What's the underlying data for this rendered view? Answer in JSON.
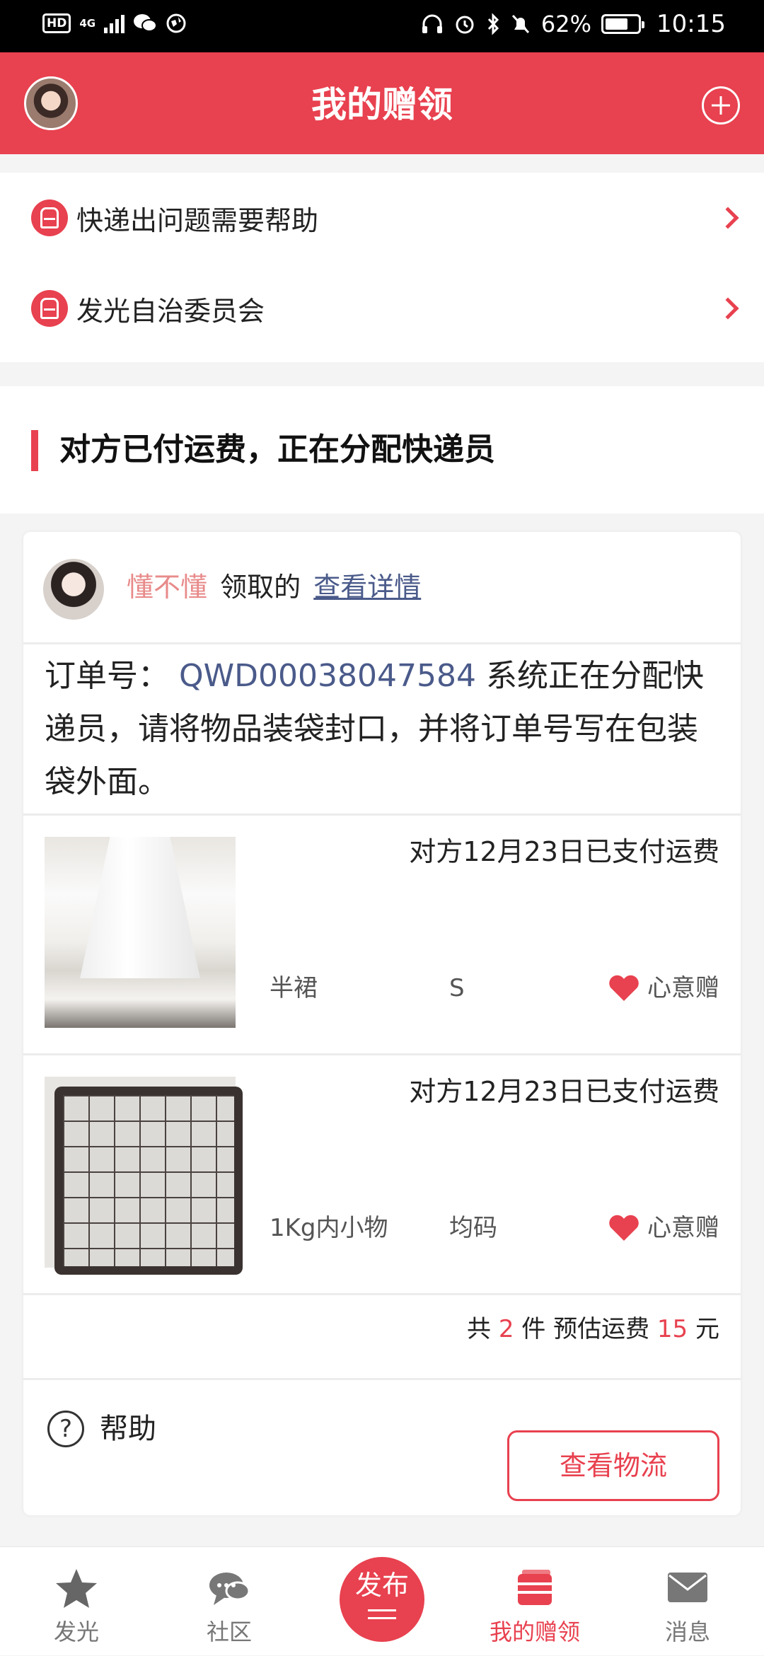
{
  "status_bar": {
    "hd": "HD",
    "network": "4G",
    "battery": "62%",
    "time": "10:15"
  },
  "header": {
    "title": "我的赠领"
  },
  "help_links": [
    {
      "label": "快递出问题需要帮助"
    },
    {
      "label": "发光自治委员会"
    }
  ],
  "section": {
    "title": "对方已付运费，正在分配快递员"
  },
  "order": {
    "claimer_name": "懂不懂",
    "claim_verb": "领取的",
    "detail_link": "查看详情",
    "order_label": "订单号：",
    "order_number": "QWD00038047584",
    "instruction": "系统正在分配快递员，请将物品装袋封口，并将订单号写在包装袋外面。",
    "items": [
      {
        "paid_text": "对方12月23日已支付运费",
        "name": "半裙",
        "size": "S",
        "gift_label": "心意赠"
      },
      {
        "paid_text": "对方12月23日已支付运费",
        "name": "1Kg内小物",
        "size": "均码",
        "gift_label": "心意赠"
      }
    ],
    "summary": {
      "prefix": "共",
      "count": "2",
      "count_unit": "件 预估运费",
      "fee": "15",
      "fee_unit": "元"
    },
    "help_label": "帮助",
    "logistics_button": "查看物流"
  },
  "bottom_nav": {
    "items": [
      {
        "label": "发光",
        "icon": "star-icon"
      },
      {
        "label": "社区",
        "icon": "chat-bubble-icon"
      },
      {
        "label": "发布",
        "icon": "publish-icon"
      },
      {
        "label": "我的赠领",
        "icon": "gift-box-icon"
      },
      {
        "label": "消息",
        "icon": "mail-icon"
      }
    ],
    "active": "我的赠领"
  },
  "colors": {
    "brand_red": "#e8414f",
    "link_blue": "#4a5a8a",
    "claimer_pink": "#e88a8a"
  }
}
